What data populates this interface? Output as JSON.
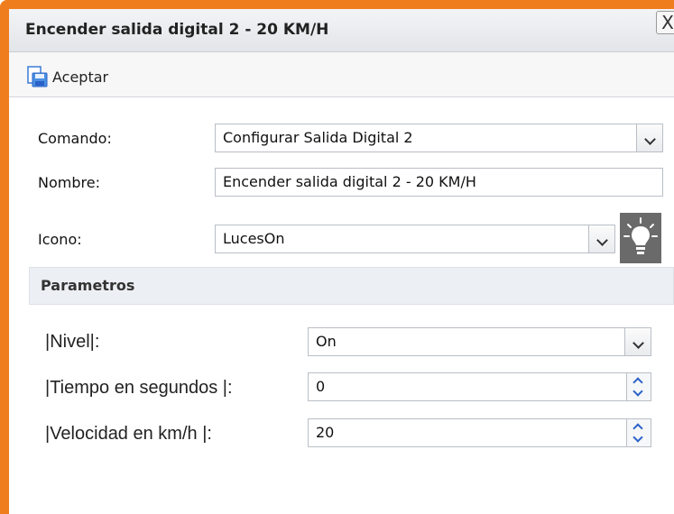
{
  "dialog": {
    "title": "Encender salida digital 2 - 20 KM/H",
    "close_label": "X"
  },
  "toolbar": {
    "accept_label": "Aceptar"
  },
  "form": {
    "comando": {
      "label": "Comando:",
      "value": "Configurar Salida Digital 2"
    },
    "nombre": {
      "label": "Nombre:",
      "value": "Encender salida digital 2 - 20 KM/H"
    },
    "icono": {
      "label": "Icono:",
      "value": "LucesOn",
      "preview_icon": "lightbulb-icon"
    }
  },
  "parametros": {
    "header": "Parametros",
    "nivel": {
      "label": "|Nivel|:",
      "value": "On"
    },
    "tiempo": {
      "label": "|Tiempo en segundos |:",
      "value": "0"
    },
    "velocidad": {
      "label": "|Velocidad en km/h |:",
      "value": "20"
    }
  },
  "colors": {
    "frame_accent": "#f07d1d",
    "spinner_arrow": "#2a62c9",
    "icon_preview_bg": "#6a6a6a"
  }
}
